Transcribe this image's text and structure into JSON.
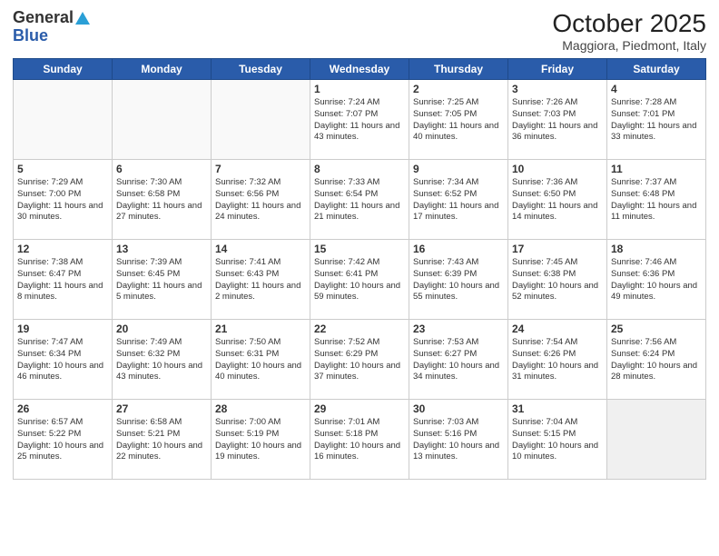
{
  "header": {
    "logo_general": "General",
    "logo_blue": "Blue",
    "month_title": "October 2025",
    "location": "Maggiora, Piedmont, Italy"
  },
  "days_of_week": [
    "Sunday",
    "Monday",
    "Tuesday",
    "Wednesday",
    "Thursday",
    "Friday",
    "Saturday"
  ],
  "weeks": [
    [
      {
        "day": "",
        "empty": true
      },
      {
        "day": "",
        "empty": true
      },
      {
        "day": "",
        "empty": true
      },
      {
        "day": "1",
        "sunrise": "7:24 AM",
        "sunset": "7:07 PM",
        "daylight": "11 hours and 43 minutes."
      },
      {
        "day": "2",
        "sunrise": "7:25 AM",
        "sunset": "7:05 PM",
        "daylight": "11 hours and 40 minutes."
      },
      {
        "day": "3",
        "sunrise": "7:26 AM",
        "sunset": "7:03 PM",
        "daylight": "11 hours and 36 minutes."
      },
      {
        "day": "4",
        "sunrise": "7:28 AM",
        "sunset": "7:01 PM",
        "daylight": "11 hours and 33 minutes."
      }
    ],
    [
      {
        "day": "5",
        "sunrise": "7:29 AM",
        "sunset": "7:00 PM",
        "daylight": "11 hours and 30 minutes."
      },
      {
        "day": "6",
        "sunrise": "7:30 AM",
        "sunset": "6:58 PM",
        "daylight": "11 hours and 27 minutes."
      },
      {
        "day": "7",
        "sunrise": "7:32 AM",
        "sunset": "6:56 PM",
        "daylight": "11 hours and 24 minutes."
      },
      {
        "day": "8",
        "sunrise": "7:33 AM",
        "sunset": "6:54 PM",
        "daylight": "11 hours and 21 minutes."
      },
      {
        "day": "9",
        "sunrise": "7:34 AM",
        "sunset": "6:52 PM",
        "daylight": "11 hours and 17 minutes."
      },
      {
        "day": "10",
        "sunrise": "7:36 AM",
        "sunset": "6:50 PM",
        "daylight": "11 hours and 14 minutes."
      },
      {
        "day": "11",
        "sunrise": "7:37 AM",
        "sunset": "6:48 PM",
        "daylight": "11 hours and 11 minutes."
      }
    ],
    [
      {
        "day": "12",
        "sunrise": "7:38 AM",
        "sunset": "6:47 PM",
        "daylight": "11 hours and 8 minutes."
      },
      {
        "day": "13",
        "sunrise": "7:39 AM",
        "sunset": "6:45 PM",
        "daylight": "11 hours and 5 minutes."
      },
      {
        "day": "14",
        "sunrise": "7:41 AM",
        "sunset": "6:43 PM",
        "daylight": "11 hours and 2 minutes."
      },
      {
        "day": "15",
        "sunrise": "7:42 AM",
        "sunset": "6:41 PM",
        "daylight": "10 hours and 59 minutes."
      },
      {
        "day": "16",
        "sunrise": "7:43 AM",
        "sunset": "6:39 PM",
        "daylight": "10 hours and 55 minutes."
      },
      {
        "day": "17",
        "sunrise": "7:45 AM",
        "sunset": "6:38 PM",
        "daylight": "10 hours and 52 minutes."
      },
      {
        "day": "18",
        "sunrise": "7:46 AM",
        "sunset": "6:36 PM",
        "daylight": "10 hours and 49 minutes."
      }
    ],
    [
      {
        "day": "19",
        "sunrise": "7:47 AM",
        "sunset": "6:34 PM",
        "daylight": "10 hours and 46 minutes."
      },
      {
        "day": "20",
        "sunrise": "7:49 AM",
        "sunset": "6:32 PM",
        "daylight": "10 hours and 43 minutes."
      },
      {
        "day": "21",
        "sunrise": "7:50 AM",
        "sunset": "6:31 PM",
        "daylight": "10 hours and 40 minutes."
      },
      {
        "day": "22",
        "sunrise": "7:52 AM",
        "sunset": "6:29 PM",
        "daylight": "10 hours and 37 minutes."
      },
      {
        "day": "23",
        "sunrise": "7:53 AM",
        "sunset": "6:27 PM",
        "daylight": "10 hours and 34 minutes."
      },
      {
        "day": "24",
        "sunrise": "7:54 AM",
        "sunset": "6:26 PM",
        "daylight": "10 hours and 31 minutes."
      },
      {
        "day": "25",
        "sunrise": "7:56 AM",
        "sunset": "6:24 PM",
        "daylight": "10 hours and 28 minutes."
      }
    ],
    [
      {
        "day": "26",
        "sunrise": "6:57 AM",
        "sunset": "5:22 PM",
        "daylight": "10 hours and 25 minutes."
      },
      {
        "day": "27",
        "sunrise": "6:58 AM",
        "sunset": "5:21 PM",
        "daylight": "10 hours and 22 minutes."
      },
      {
        "day": "28",
        "sunrise": "7:00 AM",
        "sunset": "5:19 PM",
        "daylight": "10 hours and 19 minutes."
      },
      {
        "day": "29",
        "sunrise": "7:01 AM",
        "sunset": "5:18 PM",
        "daylight": "10 hours and 16 minutes."
      },
      {
        "day": "30",
        "sunrise": "7:03 AM",
        "sunset": "5:16 PM",
        "daylight": "10 hours and 13 minutes."
      },
      {
        "day": "31",
        "sunrise": "7:04 AM",
        "sunset": "5:15 PM",
        "daylight": "10 hours and 10 minutes."
      },
      {
        "day": "",
        "empty": true,
        "last": true
      }
    ]
  ],
  "labels": {
    "sunrise_prefix": "Sunrise: ",
    "sunset_prefix": "Sunset: ",
    "daylight_prefix": "Daylight: "
  }
}
